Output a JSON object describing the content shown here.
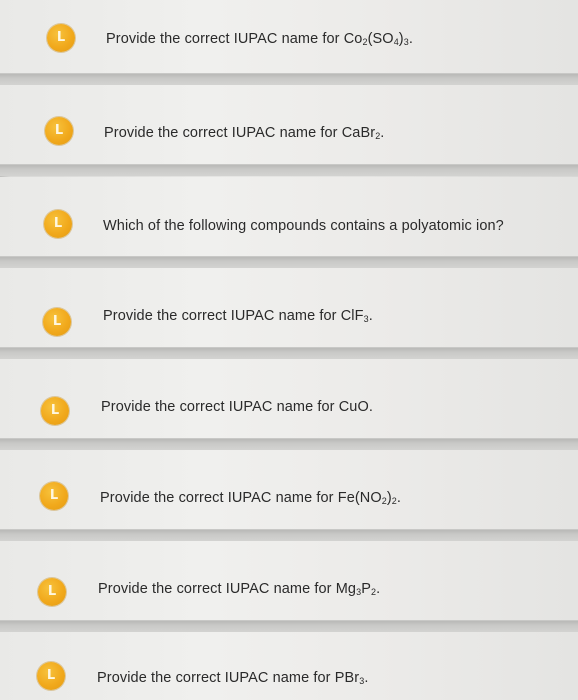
{
  "questions": [
    {
      "badge_icon": "L",
      "text_parts": [
        "Provide the correct IUPAC name for Co",
        "2",
        "(SO",
        "4",
        ")",
        "3",
        "."
      ]
    },
    {
      "badge_icon": "L",
      "text_parts": [
        "Provide the correct IUPAC name for CaBr",
        "2",
        "."
      ]
    },
    {
      "badge_icon": "L",
      "text_parts": [
        "Which of the following compounds contains a polyatomic ion?"
      ]
    },
    {
      "badge_icon": "L",
      "text_parts": [
        "Provide the correct IUPAC name for ClF",
        "3",
        "."
      ]
    },
    {
      "badge_icon": "L",
      "text_parts": [
        "Provide the correct IUPAC name for CuO."
      ]
    },
    {
      "badge_icon": "L",
      "text_parts": [
        "Provide the correct IUPAC name for Fe(NO",
        "2",
        ")",
        "2",
        "."
      ]
    },
    {
      "badge_icon": "L",
      "text_parts": [
        "Provide the correct IUPAC name for Mg",
        "3",
        "P",
        "2",
        "."
      ]
    },
    {
      "badge_icon": "L",
      "text_parts": [
        "Provide the correct IUPAC name for PBr",
        "3",
        "."
      ]
    }
  ],
  "colors": {
    "badge": "#f1a91c",
    "text": "#2a2a2a",
    "card": "#efefed",
    "separator": "#c4c4c2"
  }
}
